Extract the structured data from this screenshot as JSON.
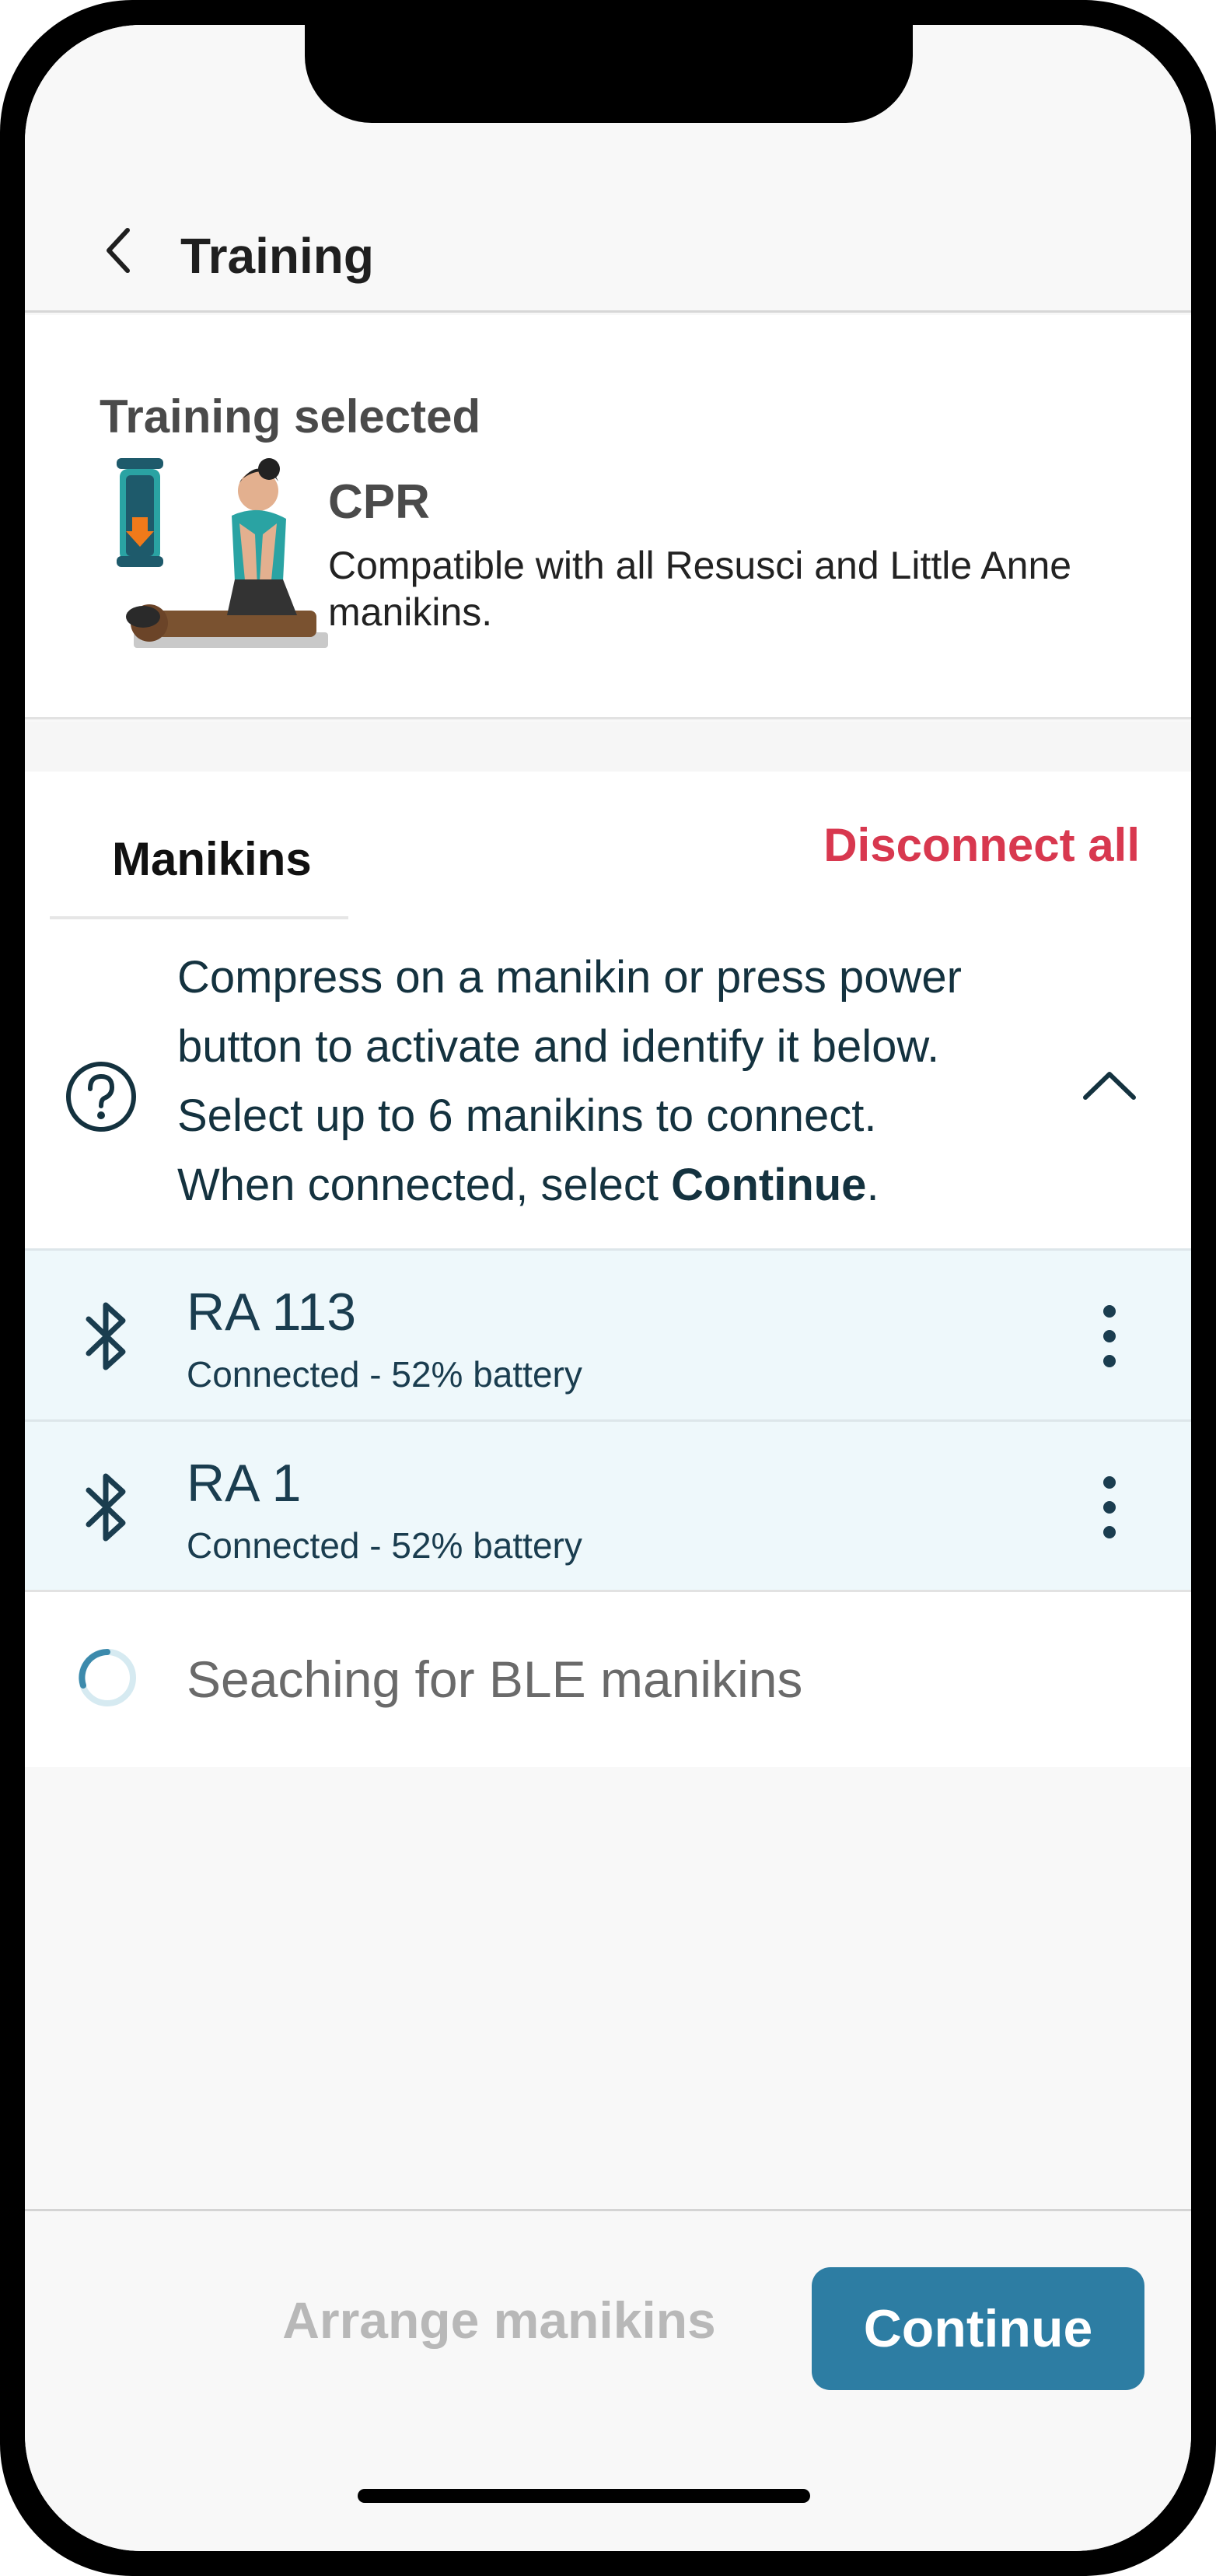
{
  "header": {
    "title": "Training",
    "back_icon": "chevron-left-icon"
  },
  "training_selected": {
    "heading": "Training selected",
    "title": "CPR",
    "description": "Compatible with all Resusci and Little Anne manikins.",
    "illustration": "cpr-illustration"
  },
  "manikins": {
    "tab_label": "Manikins",
    "disconnect_all_label": "Disconnect all",
    "info": {
      "line1": "Compress on a manikin or press power",
      "line2": "button to activate and identify it below.",
      "line3": "Select up to 6 manikins to connect.",
      "line4_prefix": "When connected, select ",
      "line4_bold": "Continue",
      "line4_suffix": ".",
      "help_icon": "question-circle-icon",
      "collapse_icon": "chevron-up-icon"
    },
    "devices": [
      {
        "name": "RA 113",
        "status": "Connected - 52% battery",
        "icon": "bluetooth-icon"
      },
      {
        "name": "RA 1",
        "status": "Connected - 52% battery",
        "icon": "bluetooth-icon"
      }
    ],
    "searching_label": "Seaching for BLE manikins"
  },
  "footer": {
    "arrange_label": "Arrange manikins",
    "continue_label": "Continue"
  },
  "colors": {
    "accent": "#2d7da3",
    "danger": "#d8384f",
    "text_dark": "#14323f",
    "row_highlight": "#eef8fb"
  }
}
